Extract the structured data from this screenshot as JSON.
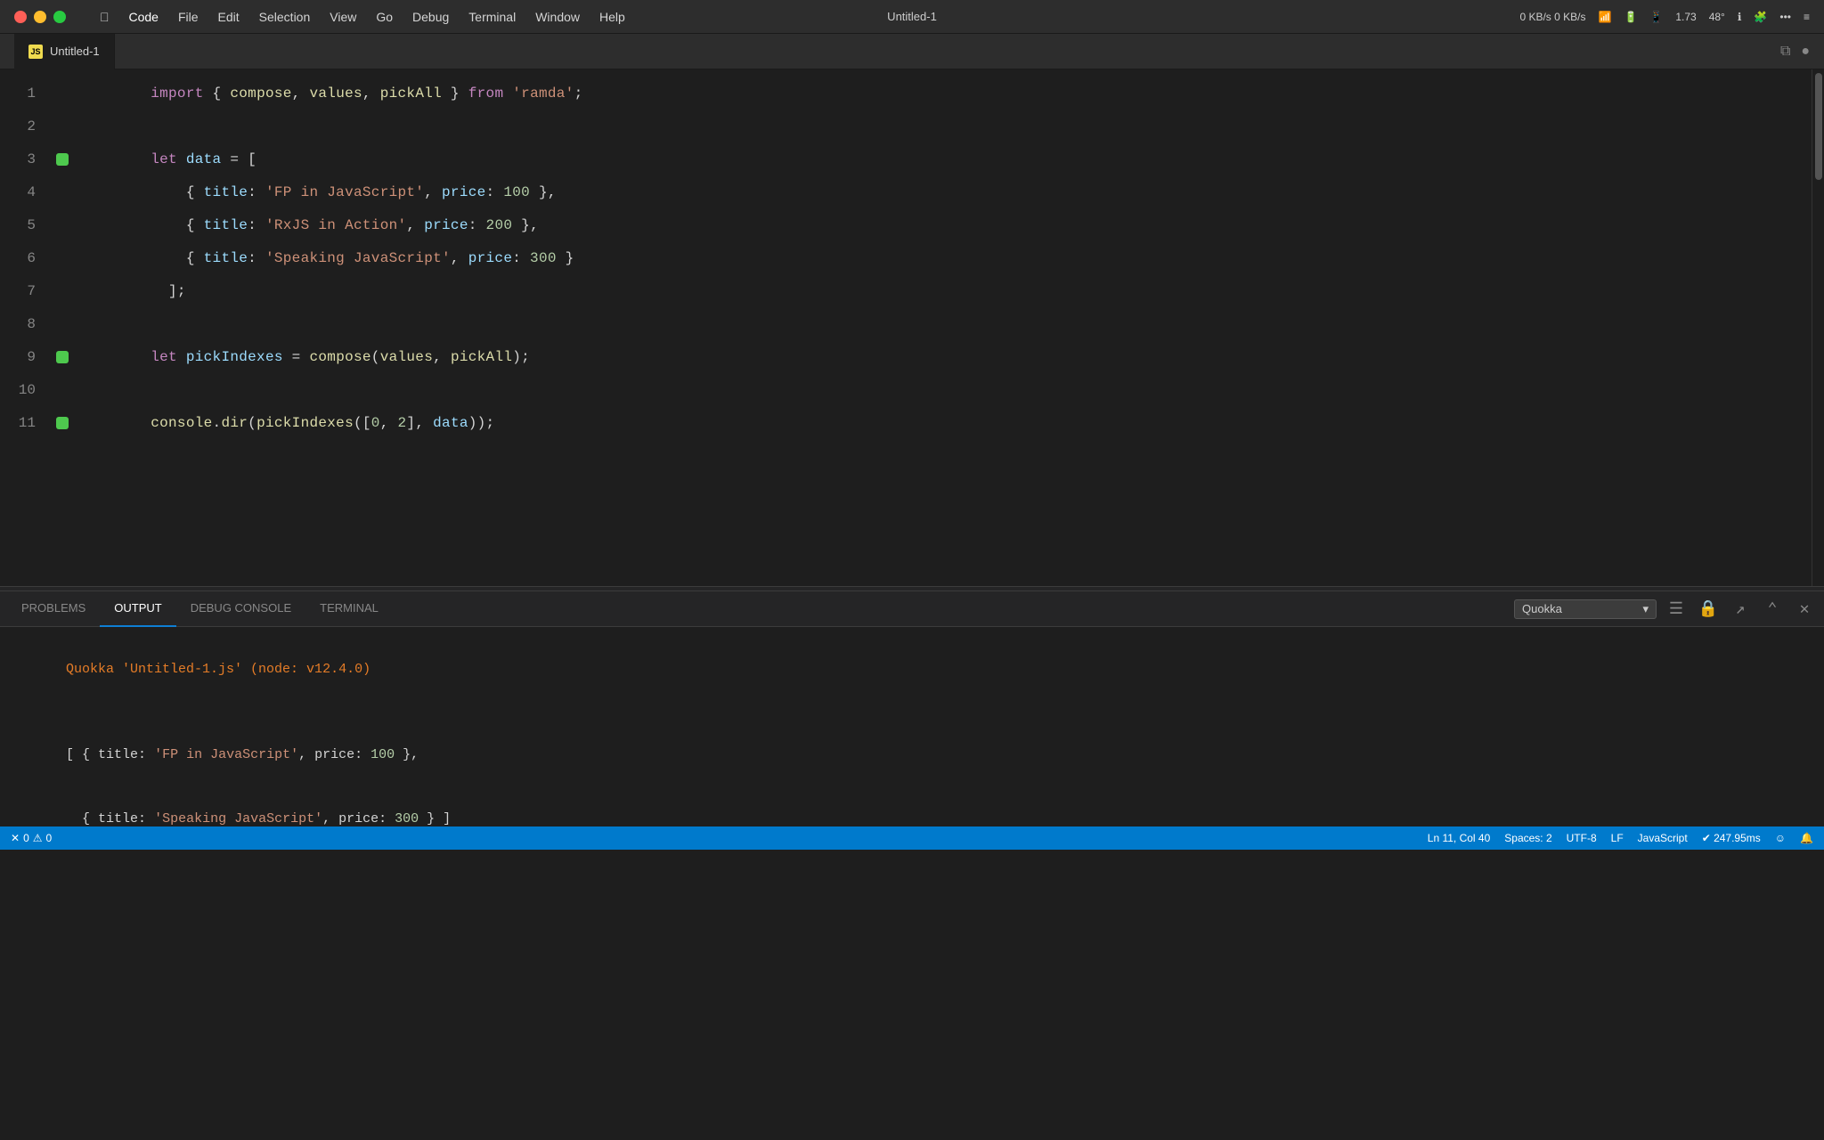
{
  "titlebar": {
    "title": "Untitled-1",
    "menu_items": [
      "Apple",
      "Code",
      "File",
      "Edit",
      "Selection",
      "View",
      "Go",
      "Debug",
      "Terminal",
      "Window",
      "Help"
    ],
    "status_right": "0 KB/s  0 KB/s",
    "battery": "48°",
    "version": "1.73"
  },
  "tab": {
    "label": "Untitled-1",
    "js_label": "JS"
  },
  "code": {
    "lines": [
      {
        "num": 1,
        "gutter": false,
        "content": "import { compose, values, pickAll } from 'ramda';"
      },
      {
        "num": 2,
        "gutter": false,
        "content": ""
      },
      {
        "num": 3,
        "gutter": true,
        "content": "let data = ["
      },
      {
        "num": 4,
        "gutter": false,
        "content": "  { title: 'FP in JavaScript', price: 100 },"
      },
      {
        "num": 5,
        "gutter": false,
        "content": "  { title: 'RxJS in Action', price: 200 },"
      },
      {
        "num": 6,
        "gutter": false,
        "content": "  { title: 'Speaking JavaScript', price: 300 }"
      },
      {
        "num": 7,
        "gutter": false,
        "content": "];"
      },
      {
        "num": 8,
        "gutter": false,
        "content": ""
      },
      {
        "num": 9,
        "gutter": true,
        "content": "let pickIndexes = compose(values, pickAll);"
      },
      {
        "num": 10,
        "gutter": false,
        "content": ""
      },
      {
        "num": 11,
        "gutter": true,
        "content": "console.dir(pickIndexes([0, 2], data));"
      }
    ]
  },
  "panel": {
    "tabs": [
      "PROBLEMS",
      "OUTPUT",
      "DEBUG CONSOLE",
      "TERMINAL"
    ],
    "active_tab": "OUTPUT",
    "dropdown_value": "Quokka",
    "output_line1": "Quokka 'Untitled-1.js' (node: v12.4.0)",
    "output_line2": "",
    "output_line3": "[ { title: 'FP in JavaScript', price: 100 },",
    "output_line4": "  { title: 'Speaking JavaScript', price: 300 } ]"
  },
  "statusbar": {
    "error_count": "0",
    "warning_count": "0",
    "position": "Ln 11, Col 40",
    "spaces": "Spaces: 2",
    "encoding": "UTF-8",
    "line_ending": "LF",
    "language": "JavaScript",
    "plugin": "✔ 247.95ms"
  }
}
